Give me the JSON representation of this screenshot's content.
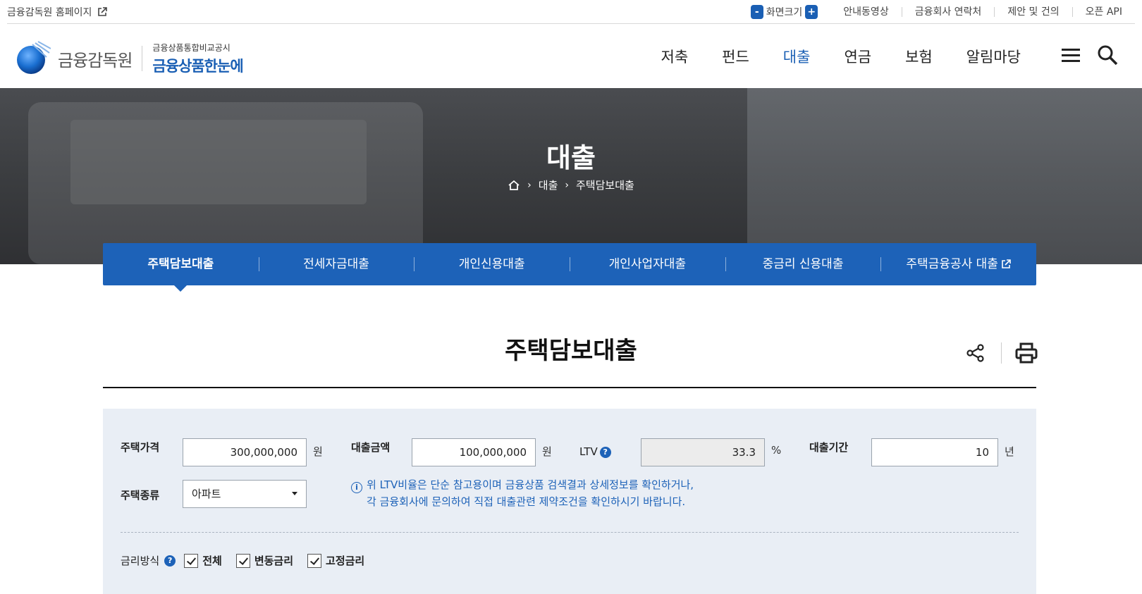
{
  "utility": {
    "home_link": "금융감독원 홈페이지",
    "zoom_minus": "-",
    "zoom_label": "화면크기",
    "zoom_plus": "+",
    "links": [
      "안내동영상",
      "금융회사 연락처",
      "제안 및 건의",
      "오픈 API"
    ]
  },
  "header": {
    "logo_name": "금융감독원",
    "logo_sub1": "금융상품통합비교공시",
    "logo_sub2": "금융상품한눈에",
    "nav": [
      "저축",
      "펀드",
      "대출",
      "연금",
      "보험",
      "알림마당"
    ],
    "active_nav": "대출"
  },
  "hero": {
    "title": "대출",
    "breadcrumb": [
      "대출",
      "주택담보대출"
    ]
  },
  "tabs": [
    "주택담보대출",
    "전세자금대출",
    "개인신용대출",
    "개인사업자대출",
    "중금리 신용대출",
    "주택금융공사 대출"
  ],
  "page": {
    "title": "주택담보대출"
  },
  "form": {
    "house_price_label": "주택가격",
    "house_price_value": "300,000,000",
    "house_price_unit": "원",
    "loan_amount_label": "대출금액",
    "loan_amount_value": "100,000,000",
    "loan_amount_unit": "원",
    "ltv_label": "LTV",
    "ltv_help": "?",
    "ltv_value": "33.3",
    "ltv_unit": "%",
    "period_label": "대출기간",
    "period_value": "10",
    "period_unit": "년",
    "house_type_label": "주택종류",
    "house_type_value": "아파트",
    "notice_line1": "위 LTV비율은 단순 참고용이며 금융상품 검색결과 상세정보를 확인하거나,",
    "notice_line2": "각 금융회사에 문의하여 직접 대출관련 제약조건을 확인하시기 바랍니다.",
    "rate_label": "금리방식",
    "rate_help": "?",
    "rate_options": [
      "전체",
      "변동금리",
      "고정금리"
    ]
  },
  "colors": {
    "primary": "#1d62b8",
    "panel_bg": "#e9eef5"
  }
}
